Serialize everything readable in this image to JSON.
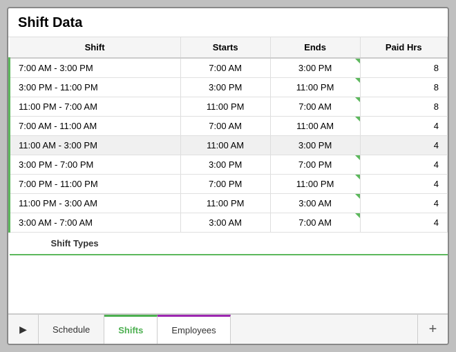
{
  "title": "Shift Data",
  "table": {
    "headers": [
      "Shift",
      "Starts",
      "Ends",
      "Paid Hrs"
    ],
    "rows": [
      {
        "shift": "7:00 AM - 3:00 PM",
        "starts": "7:00 AM",
        "ends": "3:00 PM",
        "paidHrs": "8",
        "hasIndicator": true
      },
      {
        "shift": "3:00 PM - 11:00 PM",
        "starts": "3:00 PM",
        "ends": "11:00 PM",
        "paidHrs": "8",
        "hasIndicator": true
      },
      {
        "shift": "11:00 PM - 7:00 AM",
        "starts": "11:00 PM",
        "ends": "7:00 AM",
        "paidHrs": "8",
        "hasIndicator": true
      },
      {
        "shift": "7:00 AM - 11:00 AM",
        "starts": "7:00 AM",
        "ends": "11:00 AM",
        "paidHrs": "4",
        "hasIndicator": true
      },
      {
        "shift": "11:00 AM - 3:00 PM",
        "starts": "11:00 AM",
        "ends": "3:00 PM",
        "paidHrs": "4",
        "hasIndicator": false,
        "selected": true
      },
      {
        "shift": "3:00 PM - 7:00 PM",
        "starts": "3:00 PM",
        "ends": "7:00 PM",
        "paidHrs": "4",
        "hasIndicator": true
      },
      {
        "shift": "7:00 PM - 11:00 PM",
        "starts": "7:00 PM",
        "ends": "11:00 PM",
        "paidHrs": "4",
        "hasIndicator": true
      },
      {
        "shift": "11:00 PM - 3:00 AM",
        "starts": "11:00 PM",
        "ends": "3:00 AM",
        "paidHrs": "4",
        "hasIndicator": true
      },
      {
        "shift": "3:00 AM - 7:00 AM",
        "starts": "3:00 AM",
        "ends": "7:00 AM",
        "paidHrs": "4",
        "hasIndicator": true
      }
    ],
    "shiftTypesLabel": "Shift Types"
  },
  "tabs": {
    "play_icon": "▶",
    "items": [
      {
        "label": "Schedule",
        "active": false,
        "style": "normal"
      },
      {
        "label": "Shifts",
        "active": true,
        "style": "green"
      },
      {
        "label": "Employees",
        "active": false,
        "style": "purple"
      }
    ],
    "add_icon": "+"
  }
}
